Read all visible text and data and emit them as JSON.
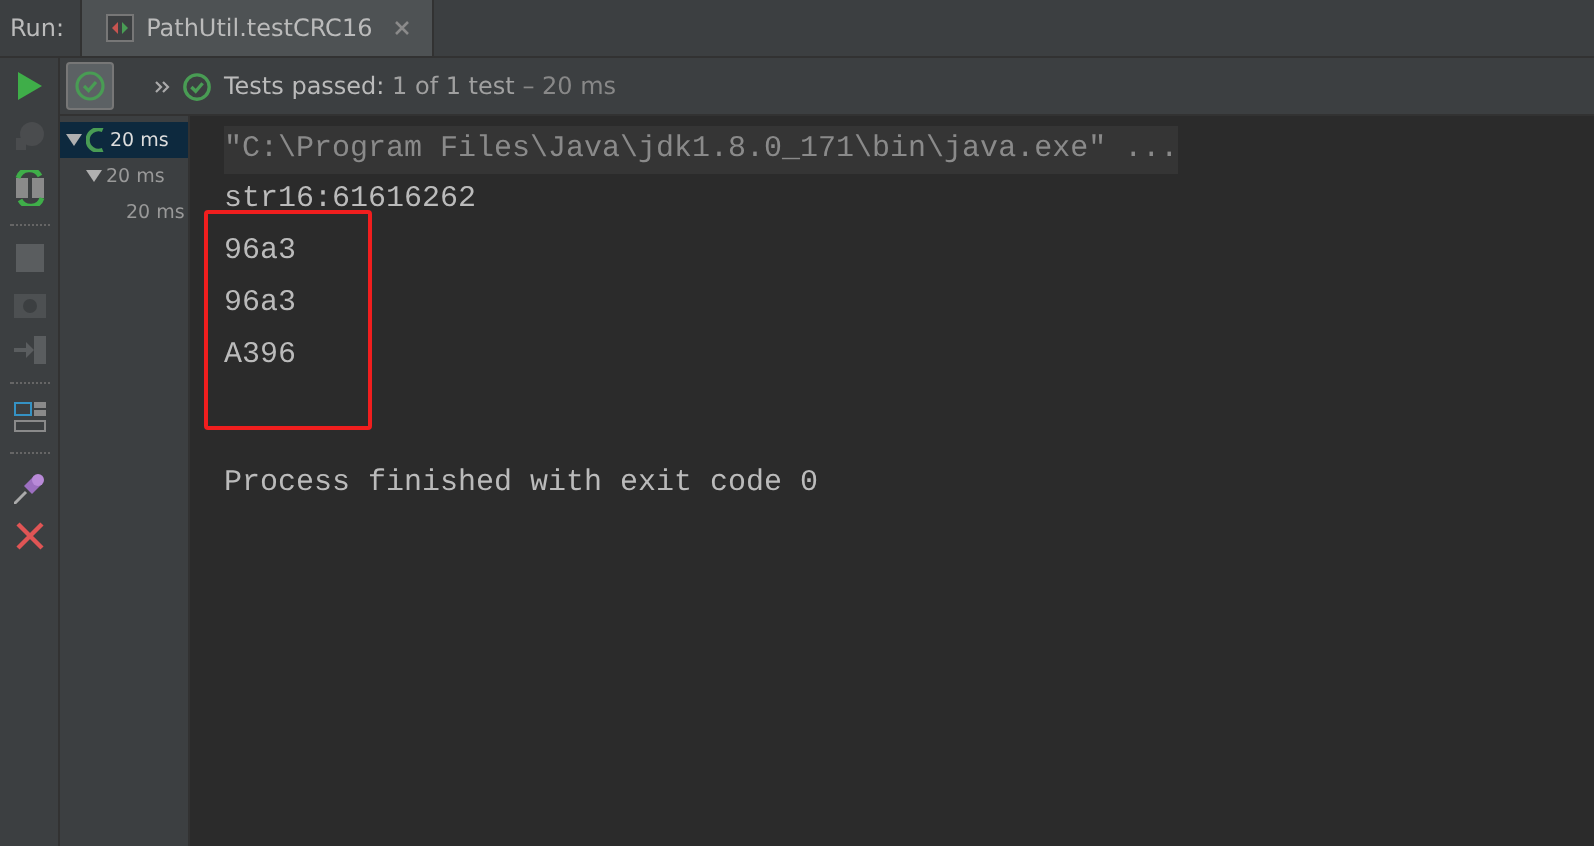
{
  "run_label": "Run:",
  "tab": {
    "title": "PathUtil.testCRC16",
    "selected": true
  },
  "status": {
    "label": "Tests passed:",
    "count": "1 of 1 test",
    "duration": "– 20 ms"
  },
  "tree": [
    {
      "label": "20 ms",
      "selected": true,
      "expanded": true,
      "children": [
        {
          "label": "20 ms",
          "selected": false,
          "expanded": true,
          "children": [
            {
              "label": "20 ms",
              "selected": false
            }
          ]
        }
      ]
    }
  ],
  "console": {
    "command": "\"C:\\Program Files\\Java\\jdk1.8.0_171\\bin\\java.exe\" ...",
    "lines": [
      {
        "text": "str16:61616262",
        "highlighted": false
      },
      {
        "text": "96a3",
        "highlighted": true
      },
      {
        "text": "96a3",
        "highlighted": true
      },
      {
        "text": "A396",
        "highlighted": true
      }
    ],
    "footer": "Process finished with exit code 0"
  }
}
